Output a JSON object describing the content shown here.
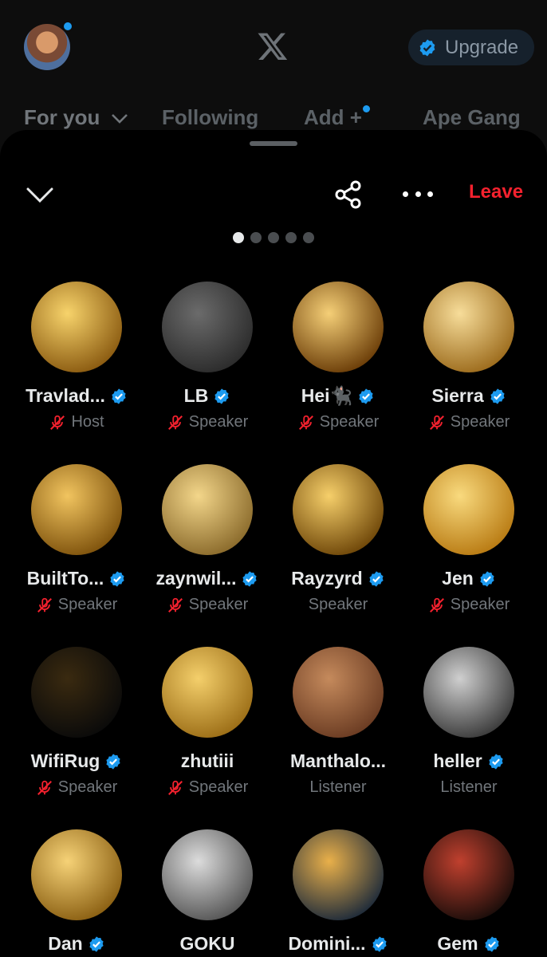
{
  "header": {
    "tabs": [
      "For you",
      "Following",
      "Add +",
      "Ape Gang"
    ],
    "upgrade_label": "Upgrade"
  },
  "sheet": {
    "leave_label": "Leave",
    "pager": {
      "total": 5,
      "active": 1
    }
  },
  "colors": {
    "verified": "#1d9bf0",
    "leave": "#f4212e",
    "muted": "#f4212e"
  },
  "participants": [
    {
      "name": "Travlad...",
      "role": "Host",
      "verified": true,
      "muted": true,
      "avatar_colors": [
        "#f7d36b",
        "#8a5a10"
      ]
    },
    {
      "name": "LB",
      "role": "Speaker",
      "verified": true,
      "muted": true,
      "avatar_colors": [
        "#6b6b6b",
        "#2b2b2b"
      ]
    },
    {
      "name": "Hei🐈‍⬛",
      "role": "Speaker",
      "verified": true,
      "muted": true,
      "avatar_colors": [
        "#f5cf77",
        "#6a3c07"
      ]
    },
    {
      "name": "Sierra",
      "role": "Speaker",
      "verified": true,
      "muted": true,
      "avatar_colors": [
        "#f7dd9a",
        "#9c6b1c"
      ]
    },
    {
      "name": "BuiltTo...",
      "role": "Speaker",
      "verified": true,
      "muted": true,
      "avatar_colors": [
        "#f1c45f",
        "#7e520c"
      ]
    },
    {
      "name": "zaynwil...",
      "role": "Speaker",
      "verified": true,
      "muted": true,
      "avatar_colors": [
        "#f3d68a",
        "#8a6a2b"
      ]
    },
    {
      "name": "Rayzyrd",
      "role": "Speaker",
      "verified": true,
      "muted": false,
      "avatar_colors": [
        "#f6cf6a",
        "#6e4608"
      ]
    },
    {
      "name": "Jen",
      "role": "Speaker",
      "verified": true,
      "muted": true,
      "avatar_colors": [
        "#f9da7e",
        "#b87a12"
      ]
    },
    {
      "name": "WifiRug",
      "role": "Speaker",
      "verified": true,
      "muted": true,
      "avatar_colors": [
        "#3a2a10",
        "#0a0a0a"
      ]
    },
    {
      "name": "zhutiii",
      "role": "Speaker",
      "verified": false,
      "muted": true,
      "avatar_colors": [
        "#f4cf6b",
        "#9b6d16"
      ]
    },
    {
      "name": "Manthalo...",
      "role": "Listener",
      "verified": false,
      "muted": false,
      "avatar_colors": [
        "#c58a5c",
        "#6a3b22"
      ]
    },
    {
      "name": "heller",
      "role": "Listener",
      "verified": true,
      "muted": false,
      "avatar_colors": [
        "#cfcfcf",
        "#3a3a3a"
      ]
    },
    {
      "name": "Dan",
      "role": "",
      "verified": true,
      "muted": false,
      "avatar_colors": [
        "#f6d277",
        "#8a5f12"
      ]
    },
    {
      "name": "GOKU",
      "role": "",
      "verified": false,
      "muted": false,
      "avatar_colors": [
        "#dcdcdc",
        "#555555"
      ]
    },
    {
      "name": "Domini...",
      "role": "",
      "verified": true,
      "muted": false,
      "avatar_colors": [
        "#e9b04a",
        "#1d2a3a"
      ]
    },
    {
      "name": "Gem",
      "role": "",
      "verified": true,
      "muted": false,
      "avatar_colors": [
        "#c0402e",
        "#1a0d0a"
      ]
    }
  ]
}
